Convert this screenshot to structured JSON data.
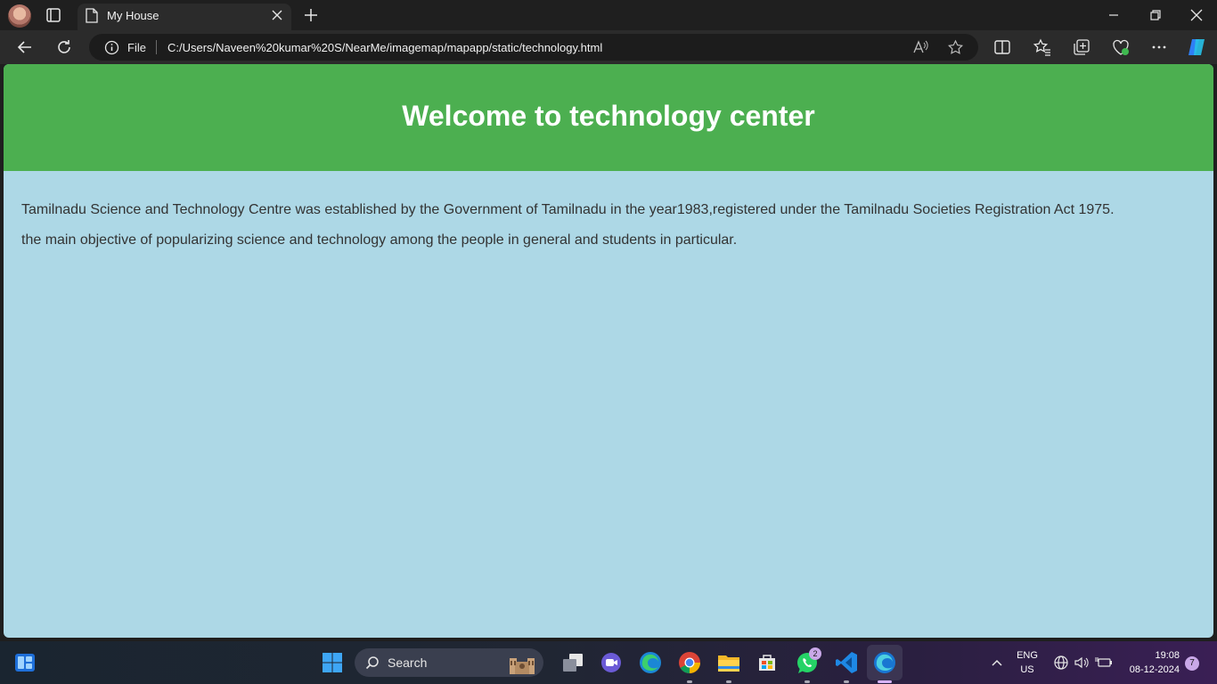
{
  "browser": {
    "tab_title": "My House",
    "address": {
      "scheme_label": "File",
      "url": "C:/Users/Naveen%20kumar%20S/NearMe/imagemap/mapapp/static/technology.html"
    }
  },
  "page": {
    "title": "Welcome to technology center",
    "paragraphs": [
      "Tamilnadu Science and Technology Centre was established by the Government of Tamilnadu in the year1983,registered under the Tamilnadu Societies Registration Act 1975.",
      "the main objective of popularizing science and technology among the people in general and students in particular."
    ],
    "colors": {
      "header_bg": "#4caf50",
      "body_bg": "#add8e6",
      "title_text": "#ffffff",
      "body_text": "#333333"
    }
  },
  "taskbar": {
    "search_label": "Search",
    "whatsapp_badge": "2",
    "language": "ENG",
    "region": "US",
    "time": "19:08",
    "date": "08-12-2024",
    "notification_count": "7",
    "apps": [
      "widgets-icon",
      "start-icon",
      "search-icon",
      "task-view-icon",
      "meet-icon",
      "edge-icon",
      "chrome-icon",
      "file-explorer-icon",
      "microsoft-store-icon",
      "whatsapp-icon",
      "vscode-icon",
      "edge-dev-icon"
    ]
  }
}
